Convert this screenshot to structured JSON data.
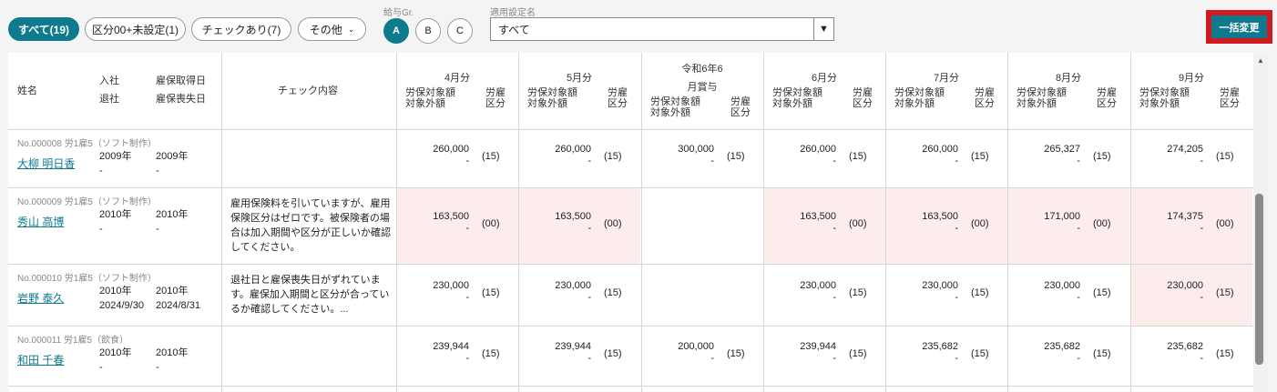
{
  "filters": {
    "all": "すべて(19)",
    "kubun": "区分00+未設定(1)",
    "check": "チェックあり(7)",
    "other": "その他"
  },
  "grade": {
    "label": "給与Gr.",
    "options": [
      "A",
      "B",
      "C"
    ],
    "selected": "A"
  },
  "setting": {
    "label": "適用設定名",
    "value": "すべて"
  },
  "bulk_button": "一括変更",
  "header": {
    "name": "姓名",
    "join": "入社",
    "leave": "退社",
    "ins_get": "雇保取得日",
    "ins_lost": "雇保喪失日",
    "check": "チェック内容",
    "amt1": "労保対象額",
    "amt2": "対象外額",
    "kubun1": "労雇",
    "kubun2": "区分",
    "months": [
      "4月分",
      "5月分",
      "令和6年6",
      "6月分",
      "7月分",
      "8月分",
      "9月分"
    ],
    "bonus_sub": "月賞与"
  },
  "rows": [
    {
      "meta": "No.000008 労1雇5（ソフト制作）",
      "name": "大柳 明日香",
      "join": "2009年",
      "leave": "-",
      "ins_get": "2009年",
      "ins_lost": "-",
      "check": "",
      "cells": [
        {
          "amt": "260,000",
          "ex": "-",
          "k": "(15)"
        },
        {
          "amt": "260,000",
          "ex": "-",
          "k": "(15)"
        },
        {
          "amt": "300,000",
          "ex": "-",
          "k": "(15)"
        },
        {
          "amt": "260,000",
          "ex": "-",
          "k": "(15)"
        },
        {
          "amt": "260,000",
          "ex": "-",
          "k": "(15)"
        },
        {
          "amt": "265,327",
          "ex": "-",
          "k": "(15)"
        },
        {
          "amt": "274,205",
          "ex": "-",
          "k": "(15)"
        }
      ]
    },
    {
      "meta": "No.000009 労1雇5（ソフト制作）",
      "name": "秀山 高博",
      "join": "2010年",
      "leave": "-",
      "ins_get": "2010年",
      "ins_lost": "-",
      "check": "雇用保険料を引いていますが、雇用保険区分はゼロです。被保険者の場合は加入期間や区分が正しいか確認してください。",
      "cells": [
        {
          "amt": "163,500",
          "ex": "-",
          "k": "(00)"
        },
        {
          "amt": "163,500",
          "ex": "-",
          "k": "(00)"
        },
        {
          "amt": "",
          "ex": "",
          "k": ""
        },
        {
          "amt": "163,500",
          "ex": "-",
          "k": "(00)"
        },
        {
          "amt": "163,500",
          "ex": "-",
          "k": "(00)"
        },
        {
          "amt": "171,000",
          "ex": "-",
          "k": "(00)"
        },
        {
          "amt": "174,375",
          "ex": "-",
          "k": "(00)"
        }
      ]
    },
    {
      "meta": "No.000010 労1雇5（ソフト制作）",
      "name": "岩野 泰久",
      "join": "2010年",
      "leave": "2024/9/30",
      "ins_get": "2010年",
      "ins_lost": "2024/8/31",
      "check": "退社日と雇保喪失日がずれています。雇保加入期間と区分が合っているか確認してください。...",
      "cells": [
        {
          "amt": "230,000",
          "ex": "-",
          "k": "(15)"
        },
        {
          "amt": "230,000",
          "ex": "-",
          "k": "(15)"
        },
        {
          "amt": "",
          "ex": "",
          "k": ""
        },
        {
          "amt": "230,000",
          "ex": "-",
          "k": "(15)"
        },
        {
          "amt": "230,000",
          "ex": "-",
          "k": "(15)"
        },
        {
          "amt": "230,000",
          "ex": "-",
          "k": "(15)"
        },
        {
          "amt": "230,000",
          "ex": "-",
          "k": "(15)"
        }
      ]
    },
    {
      "meta": "No.000011 労1雇5（飲食）",
      "name": "和田 千春",
      "join": "2010年",
      "leave": "-",
      "ins_get": "2010年",
      "ins_lost": "-",
      "check": "",
      "cells": [
        {
          "amt": "239,944",
          "ex": "-",
          "k": "(15)"
        },
        {
          "amt": "239,944",
          "ex": "-",
          "k": "(15)"
        },
        {
          "amt": "200,000",
          "ex": "-",
          "k": "(15)"
        },
        {
          "amt": "239,944",
          "ex": "-",
          "k": "(15)"
        },
        {
          "amt": "235,682",
          "ex": "-",
          "k": "(15)"
        },
        {
          "amt": "235,682",
          "ex": "-",
          "k": "(15)"
        },
        {
          "amt": "235,682",
          "ex": "-",
          "k": "(15)"
        }
      ]
    }
  ],
  "highlight_color": "#fdecec",
  "accent_color": "#0f7a8e"
}
